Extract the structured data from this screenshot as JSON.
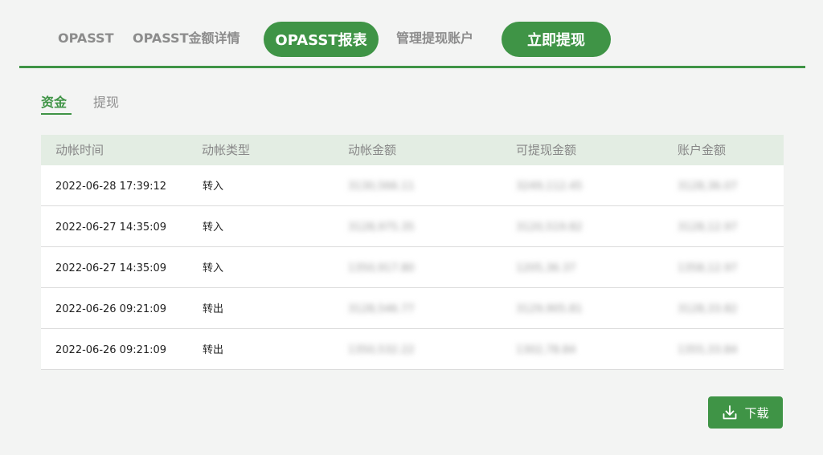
{
  "nav": {
    "items": [
      {
        "label": "OPASST",
        "active": false
      },
      {
        "label": "OPASST金额详情",
        "active": false
      },
      {
        "label": "OPASST报表",
        "active": true
      },
      {
        "label": "管理提现账户",
        "active": false
      }
    ],
    "withdraw_button": "立即提现"
  },
  "subtabs": [
    {
      "label": "资金",
      "active": true
    },
    {
      "label": "提现",
      "active": false
    }
  ],
  "table": {
    "headers": [
      "动帐时间",
      "动帐类型",
      "动帐金额",
      "可提现金额",
      "账户金额"
    ],
    "rows": [
      {
        "time": "2022-06-28  17:39:12",
        "type": "转入",
        "amount": "3130,566.11",
        "withdrawable": "3249,112.45",
        "balance": "3128,36.07"
      },
      {
        "time": "2022-06-27  14:35:09",
        "type": "转入",
        "amount": "3128,975.35",
        "withdrawable": "3120,519.82",
        "balance": "3128,12.97"
      },
      {
        "time": "2022-06-27  14:35:09",
        "type": "转入",
        "amount": "1350,917.80",
        "withdrawable": "1205,36.37",
        "balance": "1358,12.97"
      },
      {
        "time": "2022-06-26  09:21:09",
        "type": "转出",
        "amount": "3128,546.77",
        "withdrawable": "3129,905.81",
        "balance": "3128,33.82"
      },
      {
        "time": "2022-06-26  09:21:09",
        "type": "转出",
        "amount": "1350,532.22",
        "withdrawable": "1302,78.84",
        "balance": "1355,33.84"
      }
    ]
  },
  "download": {
    "label": "下载",
    "icon": "download-icon"
  },
  "colors": {
    "accent": "#3f9446",
    "header_bg": "#e3ede3",
    "page_bg": "#f3f4f3"
  }
}
